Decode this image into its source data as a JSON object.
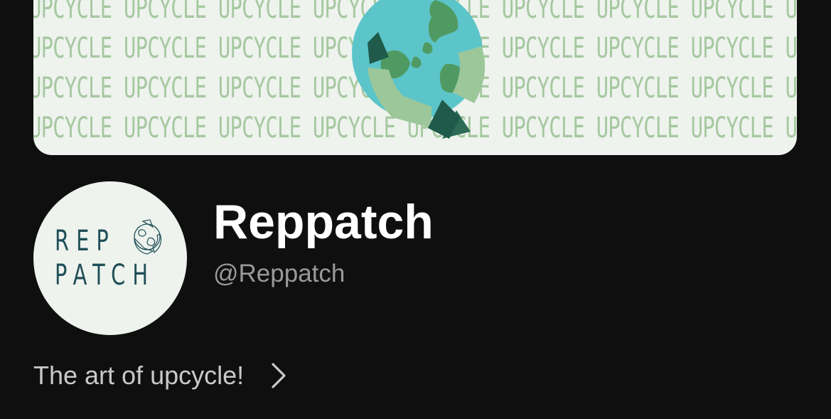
{
  "banner": {
    "pattern_word": "UPCYCLE",
    "pattern_color": "#a6c8a0",
    "background_color": "#eef3ee",
    "logo_icon": "earth-recycle-icon"
  },
  "profile": {
    "avatar": {
      "line1": "REP",
      "line2": "PATCH",
      "text_color": "#1f4f57",
      "mini_icon": "earth-recycle-icon"
    },
    "display_name": "Reppatch",
    "handle": "@Reppatch",
    "bio": "The art of upcycle!",
    "bio_chevron": "chevron-right-icon"
  }
}
